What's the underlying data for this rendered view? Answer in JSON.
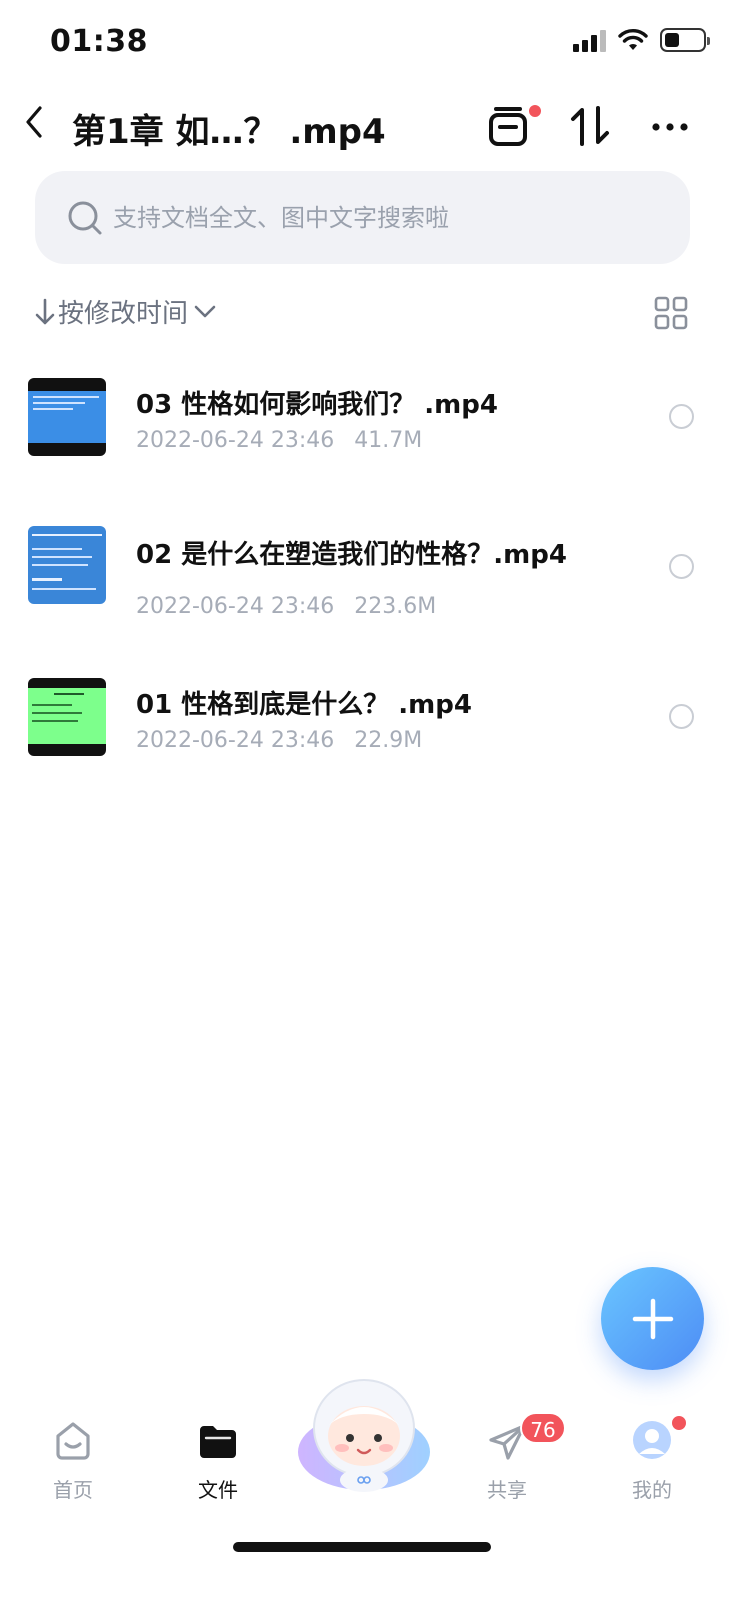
{
  "status": {
    "time": "01:38"
  },
  "header": {
    "title": "第1章 如…？ .mp4",
    "back_icon": "chevron-left-icon",
    "clip_icon": "clipboard-icon",
    "sort_icon": "up-down-arrows-icon",
    "more_icon": "more-horizontal-icon"
  },
  "search": {
    "placeholder": "支持文档全文、图中文字搜索啦"
  },
  "sort": {
    "label": "按修改时间"
  },
  "files": [
    {
      "name": "03 性格如何影响我们？ .mp4",
      "date": "2022-06-24 23:46",
      "size": "41.7M",
      "thumb_color": "#3b8ee6"
    },
    {
      "name": "02 是什么在塑造我们的性格？.mp4",
      "date": "2022-06-24 23:46",
      "size": "223.6M",
      "thumb_color": "#3a86d8"
    },
    {
      "name": "01 性格到底是什么？ .mp4",
      "date": "2022-06-24 23:46",
      "size": "22.9M",
      "thumb_color": "#7dff8c"
    }
  ],
  "tabs": [
    {
      "label": "首页",
      "icon": "home-icon"
    },
    {
      "label": "文件",
      "icon": "folder-icon"
    },
    {
      "label": "共享",
      "icon": "send-icon"
    },
    {
      "label": "我的",
      "icon": "user-avatar-icon"
    }
  ],
  "share_badge": "76",
  "colors": {
    "accent": "#4d8cf5",
    "badge": "#f2545b"
  }
}
